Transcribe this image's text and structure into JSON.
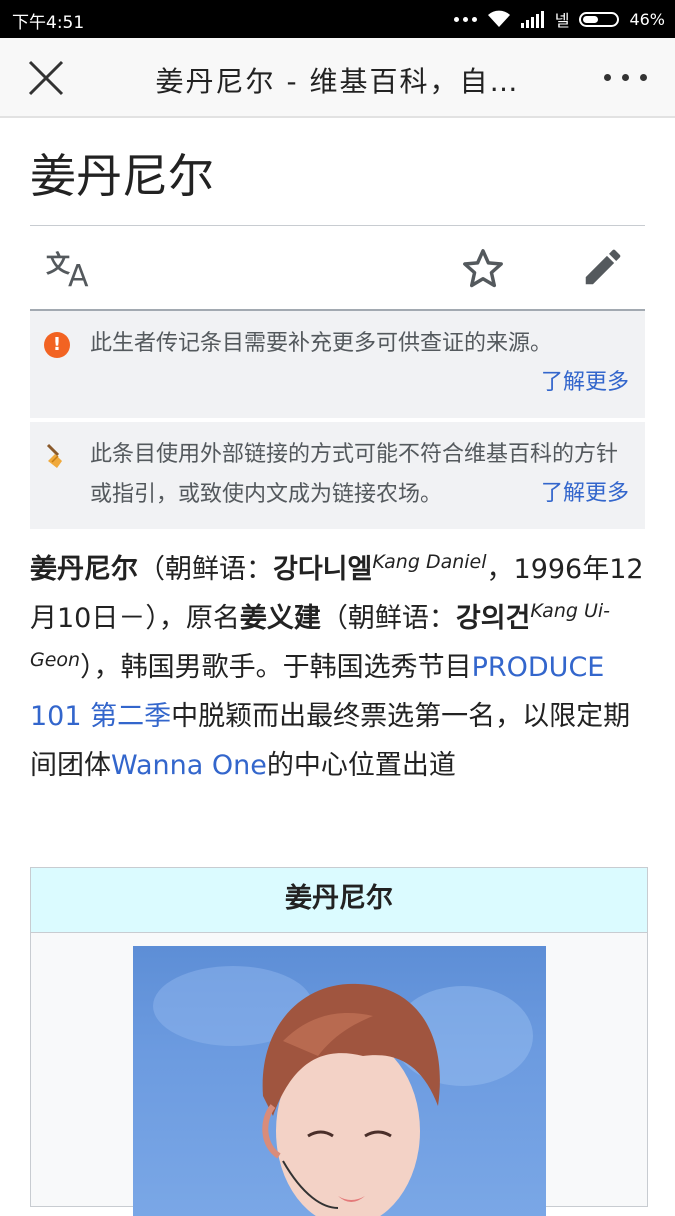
{
  "status_bar": {
    "time": "下午4:51",
    "carrier": "넬",
    "battery": "46%",
    "battery_level": 0.46
  },
  "toolbar": {
    "title": "姜丹尼尔 - 维基百科，自…"
  },
  "page": {
    "heading": "姜丹尼尔"
  },
  "notices": [
    {
      "icon": "alert-icon",
      "text": "此生者传记条目需要补充更多可供查证的来源。",
      "link": "了解更多"
    },
    {
      "icon": "broom-icon",
      "text": "此条目使用外部链接的方式可能不符合维基百科的方针或指引，或致使内文成为链接农场。",
      "link": "了解更多"
    }
  ],
  "article": {
    "p": [
      "姜丹尼尔",
      "（朝鲜语：",
      "강다니엘",
      "Kang Daniel",
      "，1996年12月10日－），原名",
      "姜义建",
      "（朝鲜语：",
      "강의건",
      "Kang Ui-Geon",
      "），韩国男歌手。于韩国选秀节目",
      "PRODUCE 101 第二季",
      "中脱颖而出最终票选第一名，以限定期间团体",
      "Wanna One",
      "的中心位置出道"
    ]
  },
  "infobox": {
    "title": "姜丹尼尔"
  },
  "colors": {
    "link": "#3366cc",
    "alert": "#f26322",
    "infobox_header": "#dbfbff",
    "notice_bg": "#f1f2f4"
  }
}
